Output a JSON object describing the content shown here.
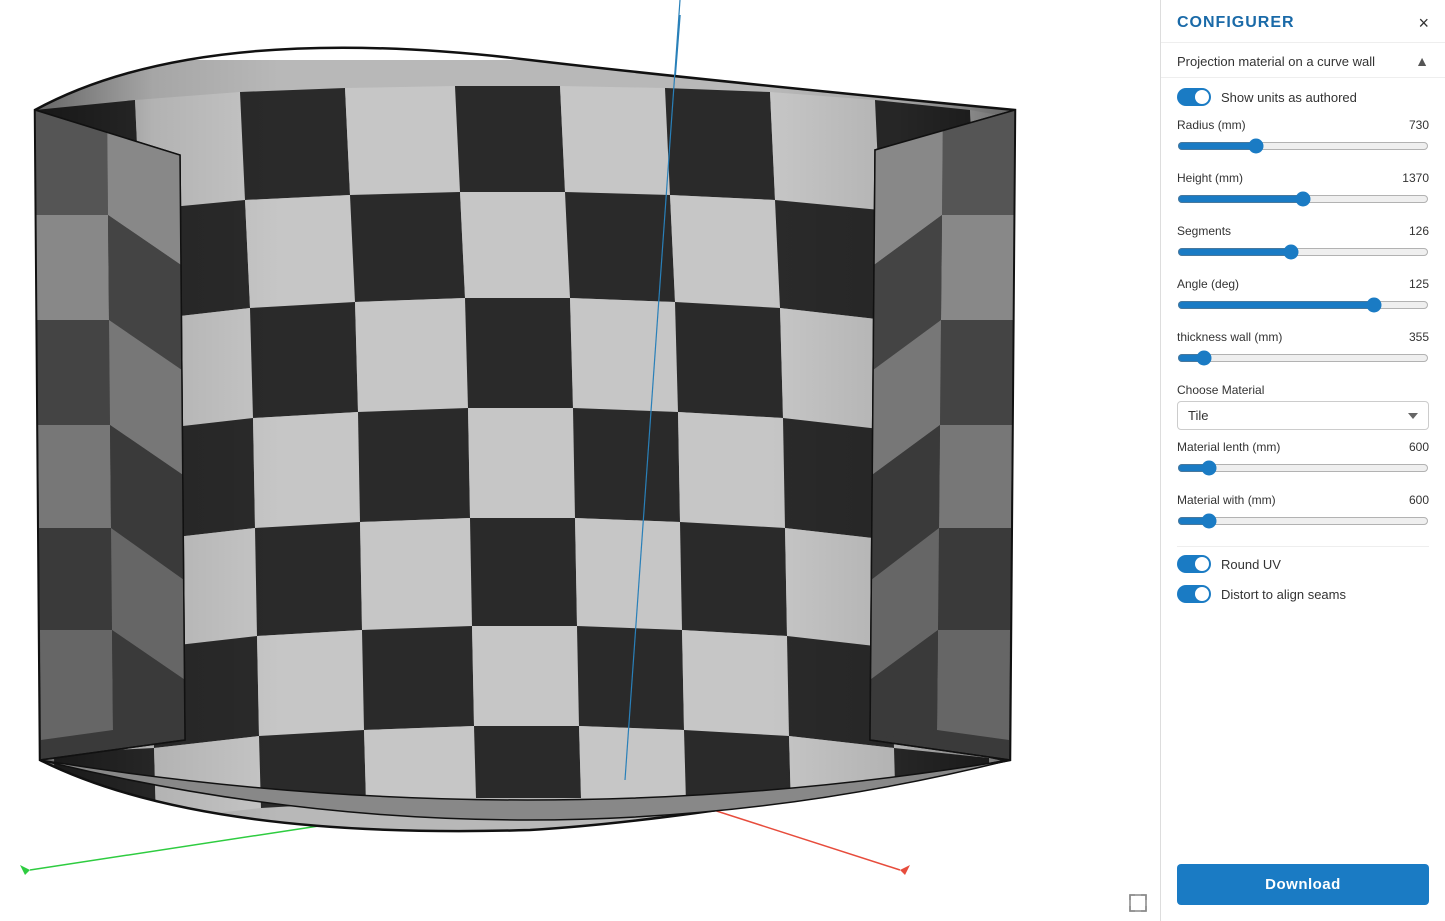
{
  "sidebar": {
    "title": "CONFIGURER",
    "close_label": "×",
    "collapse_label": "▲",
    "section_label": "Projection material on a curve wall",
    "show_units_label": "Show units as authored",
    "show_units_checked": true,
    "params": [
      {
        "name": "Radius (mm)",
        "value": "730",
        "percent": 30
      },
      {
        "name": "Height (mm)",
        "value": "1370",
        "percent": 50
      },
      {
        "name": "Segments",
        "value": "126",
        "percent": 45
      },
      {
        "name": "Angle (deg)",
        "value": "125",
        "percent": 80
      },
      {
        "name": "thickness wall (mm)",
        "value": "355",
        "percent": 8
      },
      {
        "name": "Material lenth (mm)",
        "value": "600",
        "percent": 10
      },
      {
        "name": "Material with (mm)",
        "value": "600",
        "percent": 10
      }
    ],
    "choose_material_label": "Choose Material",
    "material_options": [
      "Tile"
    ],
    "material_selected": "Tile",
    "round_uv_label": "Round UV",
    "round_uv_checked": true,
    "distort_label": "Distort to align seams",
    "distort_checked": true,
    "download_label": "Download"
  },
  "viewport": {
    "expand_icon": "⤢"
  }
}
